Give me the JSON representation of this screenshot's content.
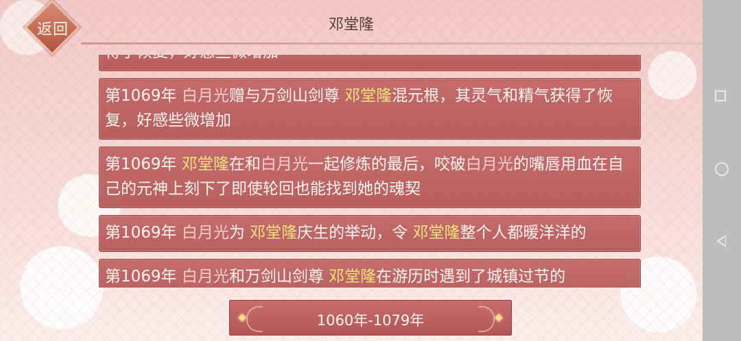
{
  "header": {
    "back_label": "返回",
    "title": "邓堂隆"
  },
  "events": [
    {
      "segments": [
        {
          "text": "得了恢复，好感些微增加",
          "type": "plain"
        }
      ]
    },
    {
      "segments": [
        {
          "text": "第1069年 ",
          "type": "plain"
        },
        {
          "text": "白月光",
          "type": "baiyue"
        },
        {
          "text": "赠与万剑山剑尊 ",
          "type": "plain"
        },
        {
          "text": "邓堂隆",
          "type": "deng"
        },
        {
          "text": "混元根，其灵气和精气获得了恢复，好感些微增加",
          "type": "plain"
        }
      ]
    },
    {
      "segments": [
        {
          "text": "第1069年 ",
          "type": "plain"
        },
        {
          "text": "邓堂隆",
          "type": "deng"
        },
        {
          "text": "在和",
          "type": "plain"
        },
        {
          "text": "白月光",
          "type": "baiyue"
        },
        {
          "text": "一起修炼的最后，咬破",
          "type": "plain"
        },
        {
          "text": "白月光",
          "type": "baiyue"
        },
        {
          "text": "的嘴唇用血在自己的元神上刻下了即使轮回也能找到她的魂契",
          "type": "plain"
        }
      ]
    },
    {
      "segments": [
        {
          "text": "第1069年 ",
          "type": "plain"
        },
        {
          "text": "白月光",
          "type": "baiyue"
        },
        {
          "text": "为 ",
          "type": "plain"
        },
        {
          "text": "邓堂隆",
          "type": "deng"
        },
        {
          "text": "庆生的举动，令 ",
          "type": "plain"
        },
        {
          "text": "邓堂隆",
          "type": "deng"
        },
        {
          "text": "整个人都暖洋洋的",
          "type": "plain"
        }
      ]
    },
    {
      "segments": [
        {
          "text": "第1069年 ",
          "type": "plain"
        },
        {
          "text": "白月光",
          "type": "baiyue"
        },
        {
          "text": "和万剑山剑尊 ",
          "type": "plain"
        },
        {
          "text": "邓堂隆",
          "type": "deng"
        },
        {
          "text": "在游历时遇到了城镇过节的",
          "type": "plain"
        }
      ]
    }
  ],
  "era": {
    "label": "1060年-1079年"
  },
  "colors": {
    "highlight_baiyue": "#f6cfc8",
    "highlight_deng": "#f5e47d",
    "card_bg": "#b95e5e"
  },
  "system_nav": {
    "icons": [
      "recent-apps-icon",
      "home-icon",
      "back-triangle-icon"
    ]
  }
}
